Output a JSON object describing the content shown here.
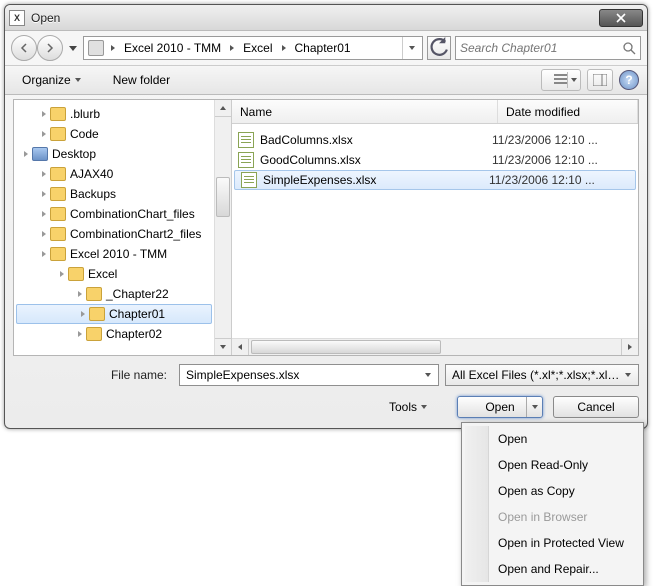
{
  "window": {
    "title": "Open"
  },
  "nav": {
    "crumbs": [
      "Excel 2010 - TMM",
      "Excel",
      "Chapter01"
    ]
  },
  "search": {
    "placeholder": "Search Chapter01"
  },
  "toolbar": {
    "organize": "Organize",
    "newfolder": "New folder"
  },
  "tree": {
    "items": [
      {
        "label": ".blurb",
        "depth": 1
      },
      {
        "label": "Code",
        "depth": 1
      },
      {
        "label": "Desktop",
        "depth": 0,
        "desk": true
      },
      {
        "label": "AJAX40",
        "depth": 1
      },
      {
        "label": "Backups",
        "depth": 1
      },
      {
        "label": "CombinationChart_files",
        "depth": 1
      },
      {
        "label": "CombinationChart2_files",
        "depth": 1
      },
      {
        "label": "Excel 2010 - TMM",
        "depth": 1
      },
      {
        "label": "Excel",
        "depth": 2
      },
      {
        "label": "_Chapter22",
        "depth": 3
      },
      {
        "label": "Chapter01",
        "depth": 3,
        "selected": true
      },
      {
        "label": "Chapter02",
        "depth": 3
      }
    ]
  },
  "list": {
    "columns": {
      "name": "Name",
      "date": "Date modified"
    },
    "rows": [
      {
        "name": "BadColumns.xlsx",
        "date": "11/23/2006 12:10 ..."
      },
      {
        "name": "GoodColumns.xlsx",
        "date": "11/23/2006 12:10 ..."
      },
      {
        "name": "SimpleExpenses.xlsx",
        "date": "11/23/2006 12:10 ...",
        "selected": true
      }
    ]
  },
  "bottom": {
    "filename_label": "File name:",
    "filename_value": "SimpleExpenses.xlsx",
    "filter_text": "All Excel Files (*.xl*;*.xlsx;*.xlsm;",
    "tools": "Tools",
    "open": "Open",
    "cancel": "Cancel"
  },
  "menu": {
    "items": [
      {
        "label": "Open"
      },
      {
        "label": "Open Read-Only"
      },
      {
        "label": "Open as Copy"
      },
      {
        "label": "Open in Browser",
        "disabled": true
      },
      {
        "label": "Open in Protected View"
      },
      {
        "label": "Open and Repair..."
      }
    ]
  }
}
